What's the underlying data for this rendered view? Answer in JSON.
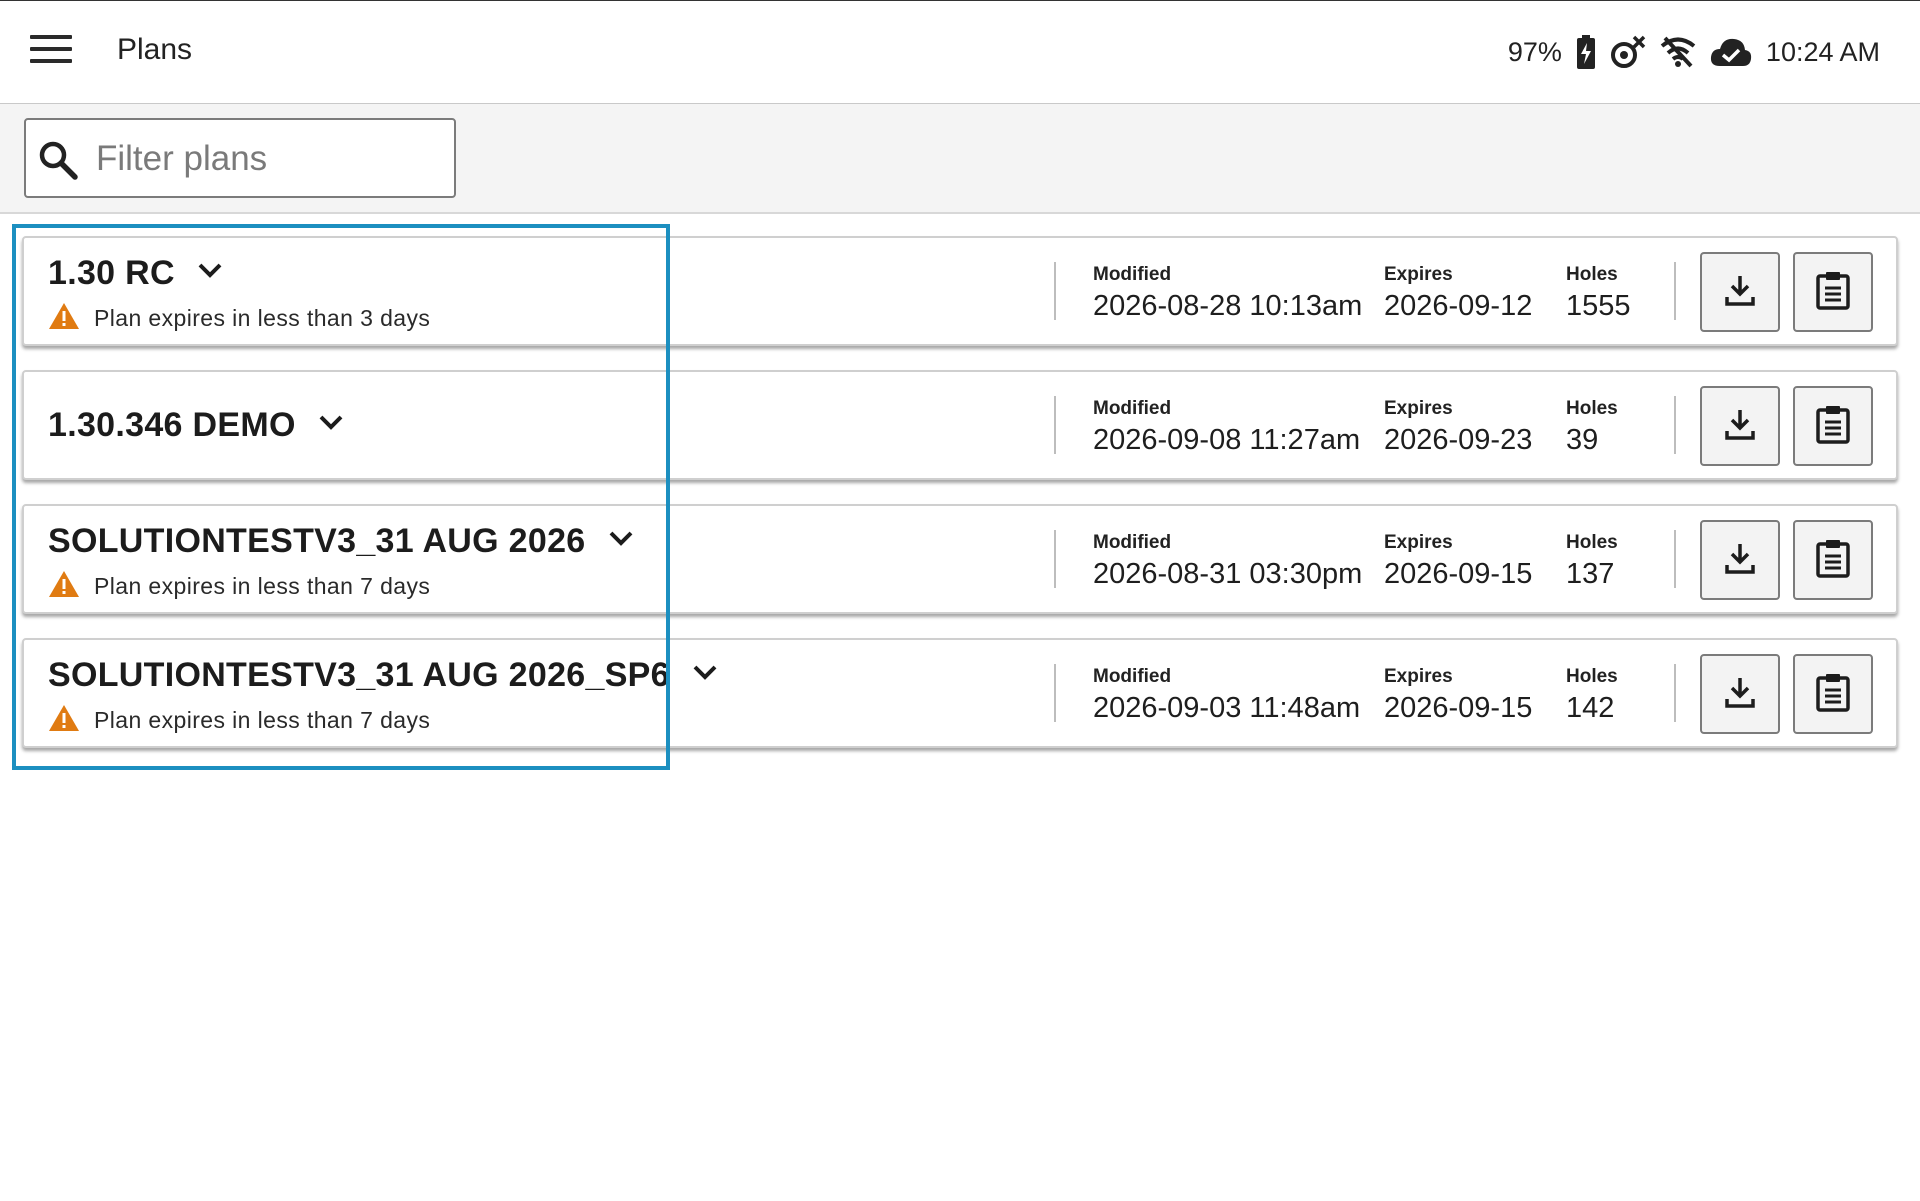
{
  "app": {
    "title": "Plans"
  },
  "status": {
    "battery": "97%",
    "time": "10:24 AM"
  },
  "filter": {
    "placeholder": "Filter plans",
    "value": ""
  },
  "labels": {
    "modified": "Modified",
    "expires": "Expires",
    "holes": "Holes"
  },
  "colors": {
    "warning": "#e07b12",
    "highlight": "#1c8fc0"
  },
  "plans": [
    {
      "name": "1.30 RC",
      "alert": "Plan expires in less than 3 days",
      "modified": "2026-08-28 10:13am",
      "expires": "2026-09-12",
      "holes": "1555"
    },
    {
      "name": "1.30.346 DEMO",
      "alert": "",
      "modified": "2026-09-08 11:27am",
      "expires": "2026-09-23",
      "holes": "39"
    },
    {
      "name": "SOLUTIONTESTV3_31 AUG 2026",
      "alert": "Plan expires in less than 7 days",
      "modified": "2026-08-31 03:30pm",
      "expires": "2026-09-15",
      "holes": "137"
    },
    {
      "name": "SOLUTIONTESTV3_31 AUG 2026_SP6",
      "alert": "Plan expires in less than 7 days",
      "modified": "2026-09-03 11:48am",
      "expires": "2026-09-15",
      "holes": "142"
    }
  ]
}
